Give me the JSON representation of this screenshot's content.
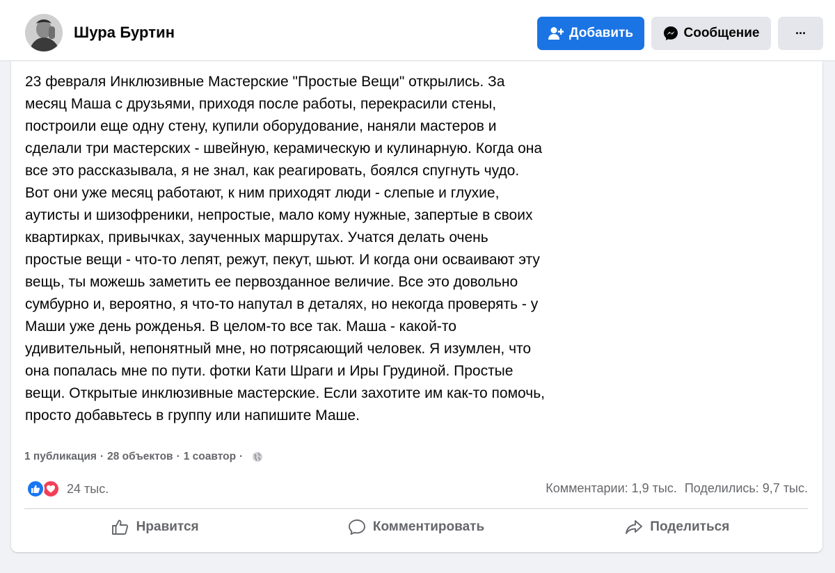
{
  "profile": {
    "name": "Шура Буртин",
    "add_button_label": "Добавить",
    "message_button_label": "Сообщение",
    "more_button_label": "···"
  },
  "post": {
    "text": "23 февраля Инклюзивные Мастерские \"Простые Вещи\" открылись. За месяц Маша с друзьями, приходя после работы, перекрасили стены, построили еще одну стену, купили оборудование, наняли мастеров и сделали три мастерских - швейную, керамическую и кулинарную. Когда она все это рассказывала, я не знал, как реагировать, боялся спугнуть чудо. Вот они уже месяц работают, к ним приходят люди - слепые и глухие, аутисты и шизофреники, непростые, мало кому нужные, запертые в своих квартирках, привычках, заученных маршрутах. Учатся делать очень простые вещи - что-то лепят, режут, пекут, шьют. И когда они осваивают эту вещь, ты можешь заметить ее первозданное величие. Все это довольно сумбурно и, вероятно, я что-то напутал в деталях, но некогда проверять - у Маши уже день рожденья. В целом-то все так. Маша - какой-то удивительный, непонятный мне, но потрясающий человек. Я изумлен, что она попалась мне по пути. фотки Кати Шраги и Иры Грудиной. Простые вещи. Открытые инклюзивные мастерские. Если захотите им как-то помочь, просто добавьтесь в группу или напишите Маше.",
    "meta": {
      "publications": "1 публикация",
      "objects": "28 объектов",
      "coauthors": "1 соавтор",
      "separator": "·"
    },
    "reactions": {
      "count": "24 тыс.",
      "icons": [
        "like-icon",
        "love-icon"
      ]
    },
    "stats": {
      "comments": "Комментарии: 1,9 тыс.",
      "shares": "Поделились: 9,7 тыс."
    },
    "actions": {
      "like": "Нравится",
      "comment": "Комментировать",
      "share": "Поделиться"
    }
  },
  "colors": {
    "background": "#f0f2f5",
    "primary_button": "#1b74e4",
    "secondary_button": "#e4e6eb",
    "muted_text": "#65676b",
    "like": "#1877f2",
    "love": "#f33e58"
  }
}
